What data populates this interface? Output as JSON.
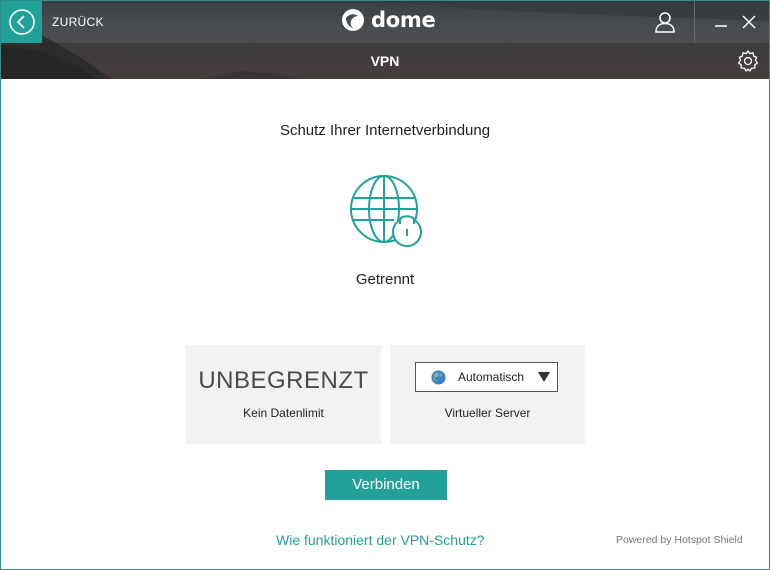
{
  "header": {
    "back_label": "ZURÜCK",
    "logo_text": "dome",
    "page_title": "VPN"
  },
  "main": {
    "heading": "Schutz Ihrer Internetverbindung",
    "status": "Getrennt",
    "data_card": {
      "value": "UNBEGRENZT",
      "caption": "Kein Datenlimit"
    },
    "server_card": {
      "selected": "Automatisch",
      "caption": "Virtueller Server"
    },
    "connect_label": "Verbinden",
    "help_link": "Wie funktioniert der VPN-Schutz?",
    "powered_by": "Powered by Hotspot Shield"
  },
  "icons": [
    "back-arrow-icon",
    "dome-logo-icon",
    "user-icon",
    "minimize-icon",
    "close-icon",
    "gear-icon",
    "globe-lock-icon",
    "earth-icon",
    "caret-down-icon"
  ],
  "colors": {
    "accent": "#22a19a",
    "header_dark": "#3b4043",
    "card_bg": "#f2f2f2"
  }
}
